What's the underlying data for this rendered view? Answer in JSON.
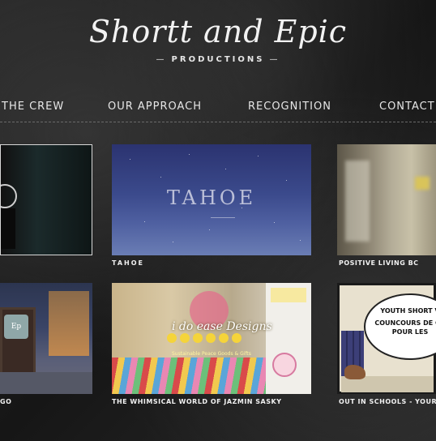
{
  "logo": {
    "script": "Shortt and Epic",
    "subtitle": "PRODUCTIONS"
  },
  "nav": {
    "items": [
      "THE CREW",
      "OUR APPROACH",
      "RECOGNITION",
      "CONTACT"
    ]
  },
  "tiles": [
    {
      "label": "",
      "thumb_text": ""
    },
    {
      "label": "TAHOE",
      "thumb_text": "TAHOE"
    },
    {
      "label": "POSITIVE LIVING BC",
      "thumb_text": ""
    },
    {
      "label": "GO",
      "thumb_text": "Ep"
    },
    {
      "label": "THE WHIMSICAL WORLD OF JAZMIN SASKY",
      "thumb_text": "i do ease Designs",
      "thumb_subtext": "Sustainable Peace Goods & Gifts"
    },
    {
      "label": "OUT IN SCHOOLS - YOUR VI",
      "thumb_text": "YOUTH SHORT V",
      "thumb_text_2": "COUNCOURS DE CO",
      "thumb_text_3": "POUR LES"
    }
  ],
  "colors": {
    "background": "#1e1e1e",
    "text": "#e8e8e8",
    "tile_border": "#d8d8d8"
  }
}
